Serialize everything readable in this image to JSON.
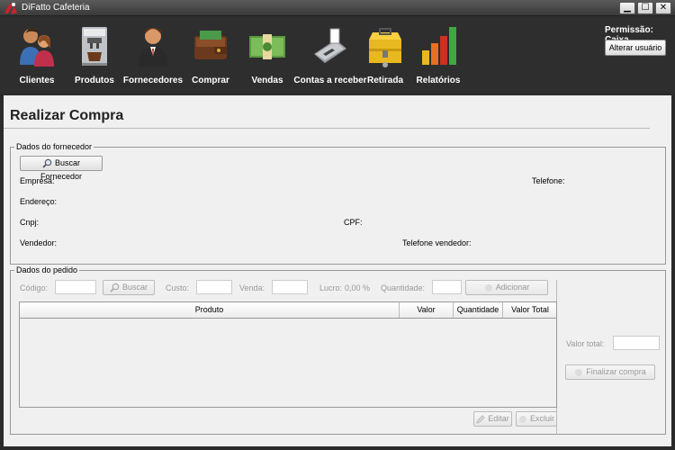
{
  "window": {
    "title": "DiFatto Cafeteria",
    "min_glyph": "▁",
    "max_glyph": "☐",
    "close_glyph": "✕"
  },
  "toolbar": {
    "items": [
      {
        "label": "Clientes",
        "icon": "clients-icon"
      },
      {
        "label": "Produtos",
        "icon": "coffee-machine-icon"
      },
      {
        "label": "Fornecedores",
        "icon": "supplier-icon"
      },
      {
        "label": "Comprar",
        "icon": "wallet-icon"
      },
      {
        "label": "Vendas",
        "icon": "money-icon"
      },
      {
        "label": "Contas a receber",
        "icon": "card-terminal-icon"
      },
      {
        "label": "Retirada",
        "icon": "cash-box-icon"
      },
      {
        "label": "Relatórios",
        "icon": "bar-chart-icon"
      }
    ],
    "permission": "Permissão: Caixa",
    "change_user": "Alterar usuário"
  },
  "page": {
    "title": "Realizar Compra"
  },
  "supplier": {
    "legend": "Dados do fornecedor",
    "search_button": "Buscar Fornecedor",
    "empresa": "Empresa:",
    "telefone": "Telefone:",
    "endereco": "Endereço:",
    "cnpj": "Cnpj:",
    "cpf": "CPF:",
    "vendedor": "Vendedor:",
    "telefone_vendedor": "Telefone vendedor:"
  },
  "order": {
    "legend": "Dados do pedido",
    "codigo": "Código:",
    "buscar": "Buscar",
    "custo": "Custo:",
    "venda": "Venda:",
    "lucro": "Lucro:",
    "lucro_value": "0,00",
    "lucro_unit": "%",
    "quantidade": "Quantidade:",
    "adicionar": "Adicionar",
    "columns": [
      "Produto",
      "Valor",
      "Quantidade",
      "Valor Total"
    ],
    "editar": "Editar",
    "excluir": "Excluir",
    "valor_total": "Valor total:",
    "finalizar": "Finalizar compra"
  },
  "colors": {
    "toolbar_bg": "#2e2e2e",
    "panel_bg": "#f0f0f0",
    "logo_red": "#d0202a"
  }
}
